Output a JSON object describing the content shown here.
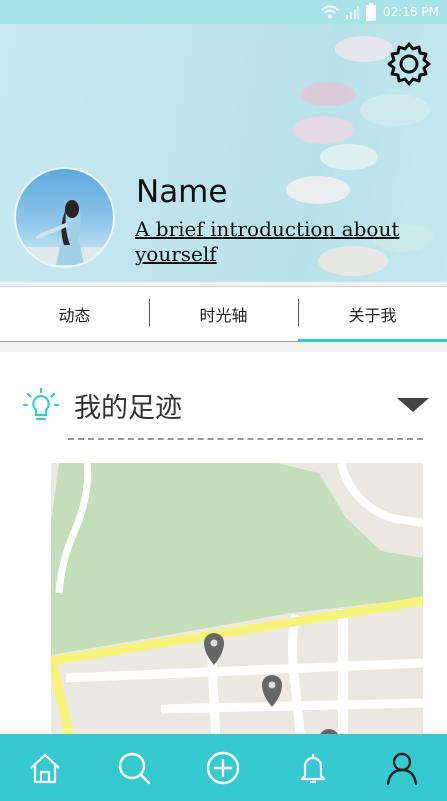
{
  "status_bar": {
    "time": "02:18 PM",
    "icons": [
      "wifi-icon",
      "signal-icon",
      "battery-icon"
    ]
  },
  "profile": {
    "name": "Name",
    "intro": "A brief introduction about yourself",
    "settings_icon": "settings-icon"
  },
  "tabs": [
    {
      "label": "动态",
      "active": false
    },
    {
      "label": "时光轴",
      "active": false
    },
    {
      "label": "关于我",
      "active": true
    }
  ],
  "section": {
    "title": "我的足迹",
    "icon": "lightbulb-icon",
    "toggle_icon": "chevron-down-icon"
  },
  "bottom_nav": [
    "home-icon",
    "search-icon",
    "add-icon",
    "bell-icon",
    "profile-icon"
  ],
  "colors": {
    "accent": "#36c9cf",
    "status_bar": "#a9e3ea",
    "park": "#c4deb9",
    "road_major": "#f7f37a"
  }
}
